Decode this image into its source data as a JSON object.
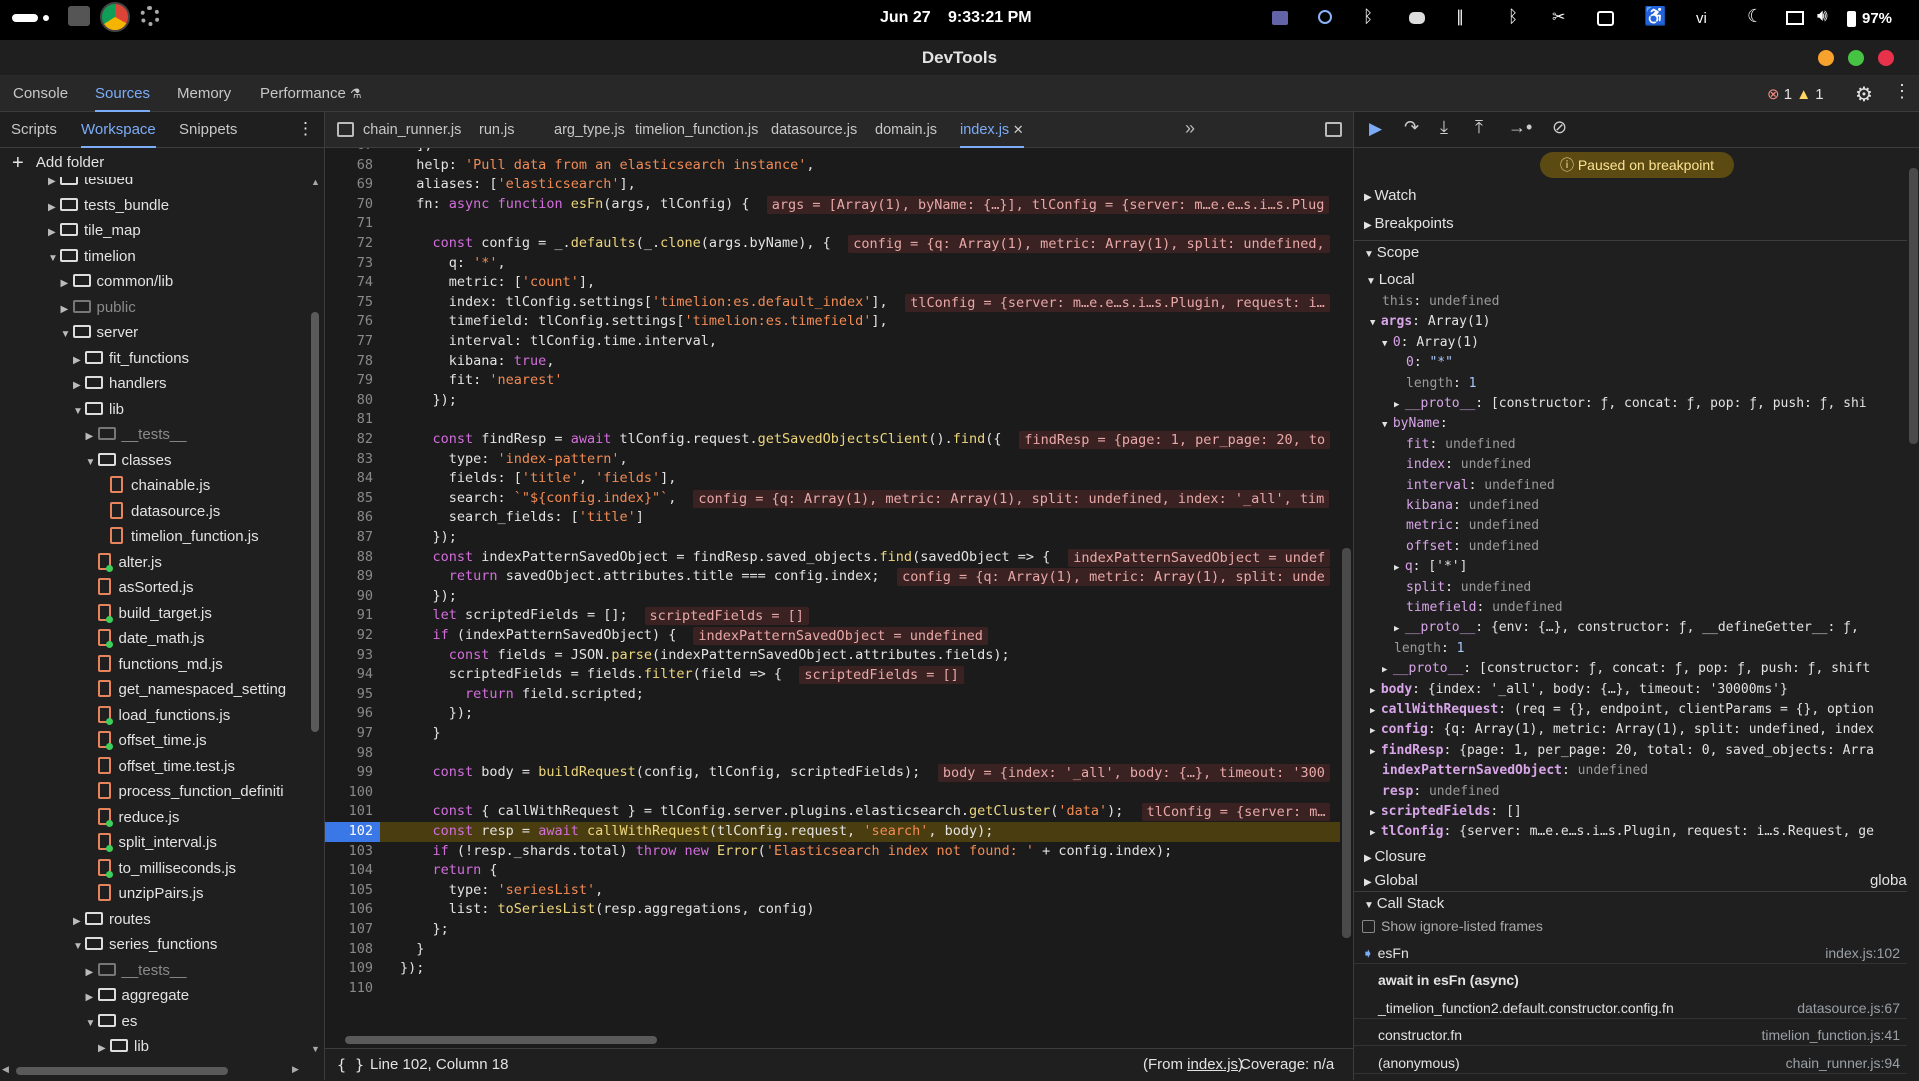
{
  "system": {
    "date": "Jun 27",
    "time": "9:33:21 PM",
    "lang": "vi",
    "battery": "97%"
  },
  "window": {
    "title": "DevTools"
  },
  "panel_tabs": [
    "Console",
    "Sources",
    "Memory",
    "Performance"
  ],
  "status": {
    "errors": "1",
    "warnings": "1"
  },
  "nav_tabs": [
    "Scripts",
    "Workspace",
    "Snippets"
  ],
  "add_folder": "Add folder",
  "tree": [
    {
      "label": "testbed",
      "type": "folder",
      "depth": 1,
      "open": false
    },
    {
      "label": "tests_bundle",
      "type": "folder",
      "depth": 1,
      "open": false
    },
    {
      "label": "tile_map",
      "type": "folder",
      "depth": 1,
      "open": false
    },
    {
      "label": "timelion",
      "type": "folder",
      "depth": 1,
      "open": true
    },
    {
      "label": "common/lib",
      "type": "folder",
      "depth": 2,
      "open": false
    },
    {
      "label": "public",
      "type": "folder",
      "depth": 2,
      "open": false,
      "dim": true
    },
    {
      "label": "server",
      "type": "folder",
      "depth": 2,
      "open": true
    },
    {
      "label": "fit_functions",
      "type": "folder",
      "depth": 3,
      "open": false
    },
    {
      "label": "handlers",
      "type": "folder",
      "depth": 3,
      "open": false
    },
    {
      "label": "lib",
      "type": "folder",
      "depth": 3,
      "open": true
    },
    {
      "label": "__tests__",
      "type": "folder",
      "depth": 4,
      "open": false,
      "dim": true
    },
    {
      "label": "classes",
      "type": "folder",
      "depth": 4,
      "open": true
    },
    {
      "label": "chainable.js",
      "type": "file",
      "depth": 5
    },
    {
      "label": "datasource.js",
      "type": "file",
      "depth": 5
    },
    {
      "label": "timelion_function.js",
      "type": "file",
      "depth": 5
    },
    {
      "label": "alter.js",
      "type": "file",
      "depth": 4,
      "dot": true
    },
    {
      "label": "asSorted.js",
      "type": "file",
      "depth": 4
    },
    {
      "label": "build_target.js",
      "type": "file",
      "depth": 4,
      "dot": true
    },
    {
      "label": "date_math.js",
      "type": "file",
      "depth": 4,
      "dot": true
    },
    {
      "label": "functions_md.js",
      "type": "file",
      "depth": 4
    },
    {
      "label": "get_namespaced_setting",
      "type": "file",
      "depth": 4
    },
    {
      "label": "load_functions.js",
      "type": "file",
      "depth": 4,
      "dot": true
    },
    {
      "label": "offset_time.js",
      "type": "file",
      "depth": 4,
      "dot": true
    },
    {
      "label": "offset_time.test.js",
      "type": "file",
      "depth": 4
    },
    {
      "label": "process_function_definiti",
      "type": "file",
      "depth": 4
    },
    {
      "label": "reduce.js",
      "type": "file",
      "depth": 4,
      "dot": true
    },
    {
      "label": "split_interval.js",
      "type": "file",
      "depth": 4,
      "dot": true
    },
    {
      "label": "to_milliseconds.js",
      "type": "file",
      "depth": 4,
      "dot": true
    },
    {
      "label": "unzipPairs.js",
      "type": "file",
      "depth": 4
    },
    {
      "label": "routes",
      "type": "folder",
      "depth": 3,
      "open": false
    },
    {
      "label": "series_functions",
      "type": "folder",
      "depth": 3,
      "open": true
    },
    {
      "label": "__tests__",
      "type": "folder",
      "depth": 4,
      "open": false,
      "dim": true
    },
    {
      "label": "aggregate",
      "type": "folder",
      "depth": 4,
      "open": false
    },
    {
      "label": "es",
      "type": "folder",
      "depth": 4,
      "open": true
    },
    {
      "label": "lib",
      "type": "folder",
      "depth": 5,
      "open": false
    },
    {
      "label": "index.js",
      "type": "file",
      "depth": 5,
      "selected": true
    }
  ],
  "editor_tabs": [
    "chain_runner.js",
    "run.js",
    "arg_type.js",
    "timelion_function.js",
    "datasource.js",
    "domain.js",
    "index.js"
  ],
  "code": [
    {
      "n": "67",
      "t": "  ],"
    },
    {
      "n": "68",
      "t": "  help: 'Pull data from an elasticsearch instance',"
    },
    {
      "n": "69",
      "t": "  aliases: ['elasticsearch'],"
    },
    {
      "n": "70",
      "t": "  fn: async function esFn(args, tlConfig) {",
      "inl": "args = [Array(1), byName: {…}], tlConfig = {server: m…e.e…s.i…s.Plug"
    },
    {
      "n": "71",
      "t": ""
    },
    {
      "n": "72",
      "t": "    const config = _.defaults(_.clone(args.byName), {",
      "inl": "config = {q: Array(1), metric: Array(1), split: undefined,"
    },
    {
      "n": "73",
      "t": "      q: '*',"
    },
    {
      "n": "74",
      "t": "      metric: ['count'],"
    },
    {
      "n": "75",
      "t": "      index: tlConfig.settings['timelion:es.default_index'],",
      "inl": "tlConfig = {server: m…e.e…s.i…s.Plugin, request: i…"
    },
    {
      "n": "76",
      "t": "      timefield: tlConfig.settings['timelion:es.timefield'],"
    },
    {
      "n": "77",
      "t": "      interval: tlConfig.time.interval,"
    },
    {
      "n": "78",
      "t": "      kibana: true,"
    },
    {
      "n": "79",
      "t": "      fit: 'nearest'"
    },
    {
      "n": "80",
      "t": "    });"
    },
    {
      "n": "81",
      "t": ""
    },
    {
      "n": "82",
      "t": "    const findResp = await tlConfig.request.getSavedObjectsClient().find({",
      "inl": "findResp = {page: 1, per_page: 20, to"
    },
    {
      "n": "83",
      "t": "      type: 'index-pattern',"
    },
    {
      "n": "84",
      "t": "      fields: ['title', 'fields'],"
    },
    {
      "n": "85",
      "t": "      search: `\"${config.index}\"`,",
      "inl": "config = {q: Array(1), metric: Array(1), split: undefined, index: '_all', tim"
    },
    {
      "n": "86",
      "t": "      search_fields: ['title']"
    },
    {
      "n": "87",
      "t": "    });"
    },
    {
      "n": "88",
      "t": "    const indexPatternSavedObject = findResp.saved_objects.find(savedObject => {",
      "inl": "indexPatternSavedObject = undef"
    },
    {
      "n": "89",
      "t": "      return savedObject.attributes.title === config.index;",
      "inl": "config = {q: Array(1), metric: Array(1), split: unde"
    },
    {
      "n": "90",
      "t": "    });"
    },
    {
      "n": "91",
      "t": "    let scriptedFields = [];",
      "inl": "scriptedFields = []"
    },
    {
      "n": "92",
      "t": "    if (indexPatternSavedObject) {",
      "inl": "indexPatternSavedObject = undefined"
    },
    {
      "n": "93",
      "t": "      const fields = JSON.parse(indexPatternSavedObject.attributes.fields);"
    },
    {
      "n": "94",
      "t": "      scriptedFields = fields.filter(field => {",
      "inl": "scriptedFields = []"
    },
    {
      "n": "95",
      "t": "        return field.scripted;"
    },
    {
      "n": "96",
      "t": "      });"
    },
    {
      "n": "97",
      "t": "    }"
    },
    {
      "n": "98",
      "t": ""
    },
    {
      "n": "99",
      "t": "    const body = buildRequest(config, tlConfig, scriptedFields);",
      "inl": "body = {index: '_all', body: {…}, timeout: '300"
    },
    {
      "n": "100",
      "t": ""
    },
    {
      "n": "101",
      "t": "    const { callWithRequest } = tlConfig.server.plugins.elasticsearch.getCluster('data');",
      "inl": "tlConfig = {server: m…"
    },
    {
      "n": "102",
      "t": "    const resp = await callWithRequest(tlConfig.request, 'search', body);",
      "current": true
    },
    {
      "n": "103",
      "t": "    if (!resp._shards.total) throw new Error('Elasticsearch index not found: ' + config.index);"
    },
    {
      "n": "104",
      "t": "    return {"
    },
    {
      "n": "105",
      "t": "      type: 'seriesList',"
    },
    {
      "n": "106",
      "t": "      list: toSeriesList(resp.aggregations, config)"
    },
    {
      "n": "107",
      "t": "    };"
    },
    {
      "n": "108",
      "t": "  }"
    },
    {
      "n": "109",
      "t": "});"
    },
    {
      "n": "110",
      "t": ""
    }
  ],
  "editor_status": {
    "position": "Line 102, Column 18",
    "from_prefix": "(From ",
    "from_file": "index.js",
    "from_suffix": ")",
    "coverage": "Coverage: n/a"
  },
  "debug": {
    "paused": "Paused on breakpoint",
    "sections": {
      "watch": "Watch",
      "breakpoints": "Breakpoints",
      "scope": "Scope",
      "local": "Local",
      "closure": "Closure",
      "global": "Global",
      "global_val": "global",
      "callstack": "Call Stack",
      "show_ignored": "Show ignore-listed frames"
    },
    "scope": [
      {
        "k": "this",
        "v": "undefined",
        "d": 0
      },
      {
        "k": "args",
        "v": "Array(1)",
        "d": 0,
        "tri": "open"
      },
      {
        "k": "0",
        "v": "Array(1)",
        "d": 1,
        "tri": "open"
      },
      {
        "k": "0",
        "v": "\"*\"",
        "d": 2
      },
      {
        "k": "length",
        "v": "1",
        "d": 2
      },
      {
        "k": "__proto__",
        "v": "[constructor: ƒ, concat: ƒ, pop: ƒ, push: ƒ, shi",
        "d": 2,
        "tri": "closed"
      },
      {
        "k": "byName",
        "v": "",
        "d": 1,
        "tri": "open"
      },
      {
        "k": "fit",
        "v": "undefined",
        "d": 2
      },
      {
        "k": "index",
        "v": "undefined",
        "d": 2
      },
      {
        "k": "interval",
        "v": "undefined",
        "d": 2
      },
      {
        "k": "kibana",
        "v": "undefined",
        "d": 2
      },
      {
        "k": "metric",
        "v": "undefined",
        "d": 2
      },
      {
        "k": "offset",
        "v": "undefined",
        "d": 2
      },
      {
        "k": "q",
        "v": "['*']",
        "d": 2,
        "tri": "closed"
      },
      {
        "k": "split",
        "v": "undefined",
        "d": 2
      },
      {
        "k": "timefield",
        "v": "undefined",
        "d": 2
      },
      {
        "k": "__proto__",
        "v": "{env: {…}, constructor: ƒ, __defineGetter__: ƒ,",
        "d": 2,
        "tri": "closed"
      },
      {
        "k": "length",
        "v": "1",
        "d": 1
      },
      {
        "k": "__proto__",
        "v": "[constructor: ƒ, concat: ƒ, pop: ƒ, push: ƒ, shift",
        "d": 1,
        "tri": "closed"
      },
      {
        "k": "body",
        "v": "{index: '_all', body: {…}, timeout: '30000ms'}",
        "d": 0,
        "tri": "closed"
      },
      {
        "k": "callWithRequest",
        "v": "(req = {}, endpoint, clientParams = {}, option",
        "d": 0,
        "tri": "closed"
      },
      {
        "k": "config",
        "v": "{q: Array(1), metric: Array(1), split: undefined, index",
        "d": 0,
        "tri": "closed"
      },
      {
        "k": "findResp",
        "v": "{page: 1, per_page: 20, total: 0, saved_objects: Arra",
        "d": 0,
        "tri": "closed"
      },
      {
        "k": "indexPatternSavedObject",
        "v": "undefined",
        "d": 0
      },
      {
        "k": "resp",
        "v": "undefined",
        "d": 0
      },
      {
        "k": "scriptedFields",
        "v": "[]",
        "d": 0,
        "tri": "closed"
      },
      {
        "k": "tlConfig",
        "v": "{server: m…e.e…s.i…s.Plugin, request: i…s.Request, ge",
        "d": 0,
        "tri": "closed"
      }
    ],
    "stack": [
      {
        "fn": "esFn",
        "loc": "index.js:102",
        "current": true
      },
      {
        "fn": "await in esFn (async)",
        "loc": "",
        "async": true
      },
      {
        "fn": "_timelion_function2.default.constructor.config.fn",
        "loc": "datasource.js:67"
      },
      {
        "fn": "constructor.fn",
        "loc": "timelion_function.js:41"
      },
      {
        "fn": "(anonymous)",
        "loc": "chain_runner.js:94"
      }
    ]
  },
  "colors": {
    "accent": "#7cacf8",
    "paused_bg": "#5b4a12",
    "paused_fg": "#fde293",
    "current_line": "#4a3d10",
    "error": "#f28b82",
    "warning": "#fdd663"
  }
}
